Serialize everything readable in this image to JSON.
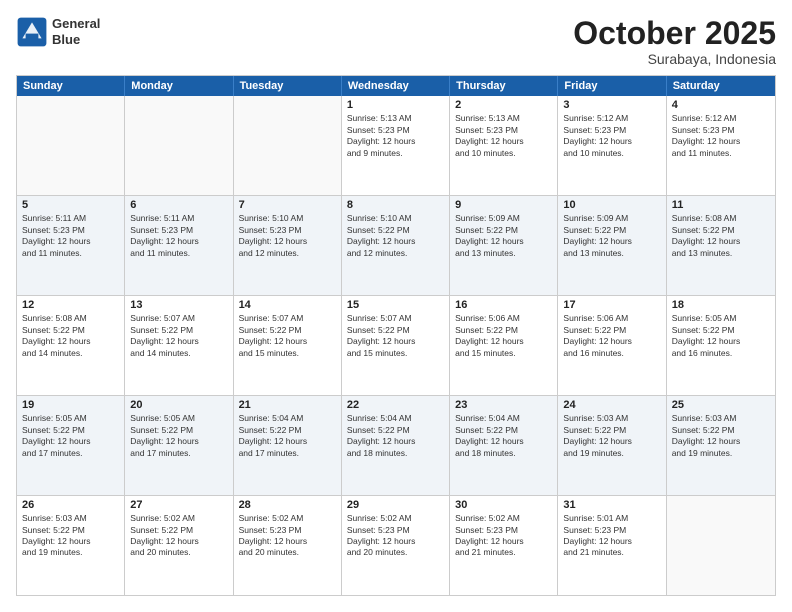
{
  "logo": {
    "line1": "General",
    "line2": "Blue"
  },
  "title": "October 2025",
  "subtitle": "Surabaya, Indonesia",
  "dayHeaders": [
    "Sunday",
    "Monday",
    "Tuesday",
    "Wednesday",
    "Thursday",
    "Friday",
    "Saturday"
  ],
  "weeks": [
    {
      "alt": false,
      "days": [
        {
          "num": "",
          "info": "",
          "empty": true
        },
        {
          "num": "",
          "info": "",
          "empty": true
        },
        {
          "num": "",
          "info": "",
          "empty": true
        },
        {
          "num": "1",
          "info": "Sunrise: 5:13 AM\nSunset: 5:23 PM\nDaylight: 12 hours\nand 9 minutes.",
          "empty": false
        },
        {
          "num": "2",
          "info": "Sunrise: 5:13 AM\nSunset: 5:23 PM\nDaylight: 12 hours\nand 10 minutes.",
          "empty": false
        },
        {
          "num": "3",
          "info": "Sunrise: 5:12 AM\nSunset: 5:23 PM\nDaylight: 12 hours\nand 10 minutes.",
          "empty": false
        },
        {
          "num": "4",
          "info": "Sunrise: 5:12 AM\nSunset: 5:23 PM\nDaylight: 12 hours\nand 11 minutes.",
          "empty": false
        }
      ]
    },
    {
      "alt": true,
      "days": [
        {
          "num": "5",
          "info": "Sunrise: 5:11 AM\nSunset: 5:23 PM\nDaylight: 12 hours\nand 11 minutes.",
          "empty": false
        },
        {
          "num": "6",
          "info": "Sunrise: 5:11 AM\nSunset: 5:23 PM\nDaylight: 12 hours\nand 11 minutes.",
          "empty": false
        },
        {
          "num": "7",
          "info": "Sunrise: 5:10 AM\nSunset: 5:23 PM\nDaylight: 12 hours\nand 12 minutes.",
          "empty": false
        },
        {
          "num": "8",
          "info": "Sunrise: 5:10 AM\nSunset: 5:22 PM\nDaylight: 12 hours\nand 12 minutes.",
          "empty": false
        },
        {
          "num": "9",
          "info": "Sunrise: 5:09 AM\nSunset: 5:22 PM\nDaylight: 12 hours\nand 13 minutes.",
          "empty": false
        },
        {
          "num": "10",
          "info": "Sunrise: 5:09 AM\nSunset: 5:22 PM\nDaylight: 12 hours\nand 13 minutes.",
          "empty": false
        },
        {
          "num": "11",
          "info": "Sunrise: 5:08 AM\nSunset: 5:22 PM\nDaylight: 12 hours\nand 13 minutes.",
          "empty": false
        }
      ]
    },
    {
      "alt": false,
      "days": [
        {
          "num": "12",
          "info": "Sunrise: 5:08 AM\nSunset: 5:22 PM\nDaylight: 12 hours\nand 14 minutes.",
          "empty": false
        },
        {
          "num": "13",
          "info": "Sunrise: 5:07 AM\nSunset: 5:22 PM\nDaylight: 12 hours\nand 14 minutes.",
          "empty": false
        },
        {
          "num": "14",
          "info": "Sunrise: 5:07 AM\nSunset: 5:22 PM\nDaylight: 12 hours\nand 15 minutes.",
          "empty": false
        },
        {
          "num": "15",
          "info": "Sunrise: 5:07 AM\nSunset: 5:22 PM\nDaylight: 12 hours\nand 15 minutes.",
          "empty": false
        },
        {
          "num": "16",
          "info": "Sunrise: 5:06 AM\nSunset: 5:22 PM\nDaylight: 12 hours\nand 15 minutes.",
          "empty": false
        },
        {
          "num": "17",
          "info": "Sunrise: 5:06 AM\nSunset: 5:22 PM\nDaylight: 12 hours\nand 16 minutes.",
          "empty": false
        },
        {
          "num": "18",
          "info": "Sunrise: 5:05 AM\nSunset: 5:22 PM\nDaylight: 12 hours\nand 16 minutes.",
          "empty": false
        }
      ]
    },
    {
      "alt": true,
      "days": [
        {
          "num": "19",
          "info": "Sunrise: 5:05 AM\nSunset: 5:22 PM\nDaylight: 12 hours\nand 17 minutes.",
          "empty": false
        },
        {
          "num": "20",
          "info": "Sunrise: 5:05 AM\nSunset: 5:22 PM\nDaylight: 12 hours\nand 17 minutes.",
          "empty": false
        },
        {
          "num": "21",
          "info": "Sunrise: 5:04 AM\nSunset: 5:22 PM\nDaylight: 12 hours\nand 17 minutes.",
          "empty": false
        },
        {
          "num": "22",
          "info": "Sunrise: 5:04 AM\nSunset: 5:22 PM\nDaylight: 12 hours\nand 18 minutes.",
          "empty": false
        },
        {
          "num": "23",
          "info": "Sunrise: 5:04 AM\nSunset: 5:22 PM\nDaylight: 12 hours\nand 18 minutes.",
          "empty": false
        },
        {
          "num": "24",
          "info": "Sunrise: 5:03 AM\nSunset: 5:22 PM\nDaylight: 12 hours\nand 19 minutes.",
          "empty": false
        },
        {
          "num": "25",
          "info": "Sunrise: 5:03 AM\nSunset: 5:22 PM\nDaylight: 12 hours\nand 19 minutes.",
          "empty": false
        }
      ]
    },
    {
      "alt": false,
      "days": [
        {
          "num": "26",
          "info": "Sunrise: 5:03 AM\nSunset: 5:22 PM\nDaylight: 12 hours\nand 19 minutes.",
          "empty": false
        },
        {
          "num": "27",
          "info": "Sunrise: 5:02 AM\nSunset: 5:22 PM\nDaylight: 12 hours\nand 20 minutes.",
          "empty": false
        },
        {
          "num": "28",
          "info": "Sunrise: 5:02 AM\nSunset: 5:23 PM\nDaylight: 12 hours\nand 20 minutes.",
          "empty": false
        },
        {
          "num": "29",
          "info": "Sunrise: 5:02 AM\nSunset: 5:23 PM\nDaylight: 12 hours\nand 20 minutes.",
          "empty": false
        },
        {
          "num": "30",
          "info": "Sunrise: 5:02 AM\nSunset: 5:23 PM\nDaylight: 12 hours\nand 21 minutes.",
          "empty": false
        },
        {
          "num": "31",
          "info": "Sunrise: 5:01 AM\nSunset: 5:23 PM\nDaylight: 12 hours\nand 21 minutes.",
          "empty": false
        },
        {
          "num": "",
          "info": "",
          "empty": true
        }
      ]
    }
  ]
}
